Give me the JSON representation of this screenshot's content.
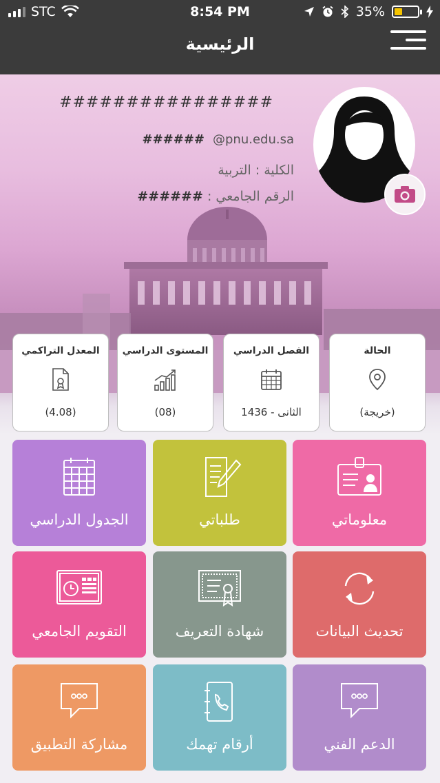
{
  "status_bar": {
    "carrier": "STC",
    "time": "8:54 PM",
    "battery": "35%"
  },
  "nav": {
    "title": "الرئيسية"
  },
  "profile": {
    "name_masked": "################",
    "email_masked": "######",
    "email_domain": "@pnu.edu.sa",
    "college_label": "الكلية :",
    "college_value": "التربية",
    "id_label": "الرقم الجامعي :",
    "id_masked": "######"
  },
  "cards": [
    {
      "title": "الحالة",
      "value": "(خريجة)",
      "icon": "location-pin-icon"
    },
    {
      "title": "الفصل الدراسي",
      "value": "الثانى - 1436",
      "icon": "calendar-icon"
    },
    {
      "title": "المستوى الدراسي",
      "value": "(08)",
      "icon": "growth-chart-icon"
    },
    {
      "title": "المعدل التراكمي",
      "value": "(4.08)",
      "icon": "certificate-document-icon"
    }
  ],
  "tiles": [
    {
      "label": "معلوماتي",
      "color": "#ef6aa6",
      "icon": "id-card-icon"
    },
    {
      "label": "طلباتي",
      "color": "#c2c23c",
      "icon": "requests-pen-icon"
    },
    {
      "label": "الجدول الدراسي",
      "color": "#b680d8",
      "icon": "schedule-calendar-icon"
    },
    {
      "label": "تحديث البيانات",
      "color": "#de6b6b",
      "icon": "refresh-icon"
    },
    {
      "label": "شهادة التعريف",
      "color": "#87978d",
      "icon": "certificate-icon"
    },
    {
      "label": "التقويم الجامعي",
      "color": "#ec5a99",
      "icon": "academic-calendar-icon"
    },
    {
      "label": "الدعم الفني",
      "color": "#b18ccb",
      "icon": "chat-bubble-icon"
    },
    {
      "label": "أرقام تهمك",
      "color": "#7dbcc7",
      "icon": "phone-book-icon"
    },
    {
      "label": "مشاركة التطبيق",
      "color": "#ee9964",
      "icon": "share-chat-icon"
    }
  ]
}
